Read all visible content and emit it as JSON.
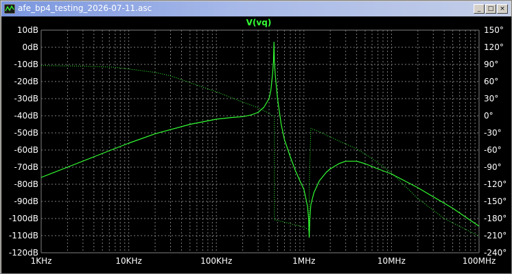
{
  "window": {
    "title": "afe_bp4_testing_2026-07-11.asc",
    "buttons": {
      "minimize": "_",
      "restore": "□",
      "close": "×"
    }
  },
  "colors": {
    "background": "#000000",
    "grid": "#808080",
    "axis_text": "#ffffff",
    "trace": "#33ff33",
    "title_text": "#33ff33"
  },
  "chart_data": {
    "type": "line",
    "title": "V(vq)",
    "x_scale": "log",
    "xlim": [
      1000,
      100000000
    ],
    "x_ticks": [
      {
        "value": 1000,
        "label": "1KHz"
      },
      {
        "value": 10000,
        "label": "10KHz"
      },
      {
        "value": 100000,
        "label": "100KHz"
      },
      {
        "value": 1000000,
        "label": "1MHz"
      },
      {
        "value": 10000000,
        "label": "10MHz"
      },
      {
        "value": 100000000,
        "label": "100MHz"
      }
    ],
    "y_left": {
      "unit": "dB",
      "ylim": [
        -120,
        10
      ],
      "ticks": [
        {
          "value": 10,
          "label": "10dB"
        },
        {
          "value": 0,
          "label": "0dB"
        },
        {
          "value": -10,
          "label": "-10dB"
        },
        {
          "value": -20,
          "label": "-20dB"
        },
        {
          "value": -30,
          "label": "-30dB"
        },
        {
          "value": -40,
          "label": "-40dB"
        },
        {
          "value": -50,
          "label": "-50dB"
        },
        {
          "value": -60,
          "label": "-60dB"
        },
        {
          "value": -70,
          "label": "-70dB"
        },
        {
          "value": -80,
          "label": "-80dB"
        },
        {
          "value": -90,
          "label": "-90dB"
        },
        {
          "value": -100,
          "label": "-100dB"
        },
        {
          "value": -110,
          "label": "-110dB"
        },
        {
          "value": -120,
          "label": "-120dB"
        }
      ]
    },
    "y_right": {
      "unit": "deg",
      "ylim": [
        -240,
        150
      ],
      "ticks": [
        {
          "value": 150,
          "label": "150°"
        },
        {
          "value": 120,
          "label": "120°"
        },
        {
          "value": 90,
          "label": "90°"
        },
        {
          "value": 60,
          "label": "60°"
        },
        {
          "value": 30,
          "label": "30°"
        },
        {
          "value": 0,
          "label": "0°"
        },
        {
          "value": -30,
          "label": "-30°"
        },
        {
          "value": -60,
          "label": "-60°"
        },
        {
          "value": -90,
          "label": "-90°"
        },
        {
          "value": -120,
          "label": "-120°"
        },
        {
          "value": -150,
          "label": "-150°"
        },
        {
          "value": -180,
          "label": "-180°"
        },
        {
          "value": -210,
          "label": "-210°"
        },
        {
          "value": -240,
          "label": "-240°"
        }
      ]
    },
    "grid": true,
    "series": [
      {
        "quantity": "magnitude",
        "axis": "left",
        "style": "solid",
        "points": [
          [
            1000,
            -76
          ],
          [
            2000,
            -70
          ],
          [
            5000,
            -62
          ],
          [
            10000,
            -56
          ],
          [
            20000,
            -50.5
          ],
          [
            50000,
            -45
          ],
          [
            100000,
            -42
          ],
          [
            150000,
            -41
          ],
          [
            200000,
            -40.5
          ],
          [
            250000,
            -39.5
          ],
          [
            300000,
            -38
          ],
          [
            350000,
            -35
          ],
          [
            400000,
            -30
          ],
          [
            420000,
            -25
          ],
          [
            440000,
            -15
          ],
          [
            450000,
            -8
          ],
          [
            455000,
            3
          ],
          [
            460000,
            -8
          ],
          [
            470000,
            -16
          ],
          [
            500000,
            -30
          ],
          [
            550000,
            -45
          ],
          [
            600000,
            -54
          ],
          [
            700000,
            -64
          ],
          [
            800000,
            -72
          ],
          [
            900000,
            -78
          ],
          [
            1000000,
            -83
          ],
          [
            1050000,
            -88
          ],
          [
            1100000,
            -93
          ],
          [
            1130000,
            -100
          ],
          [
            1150000,
            -111
          ],
          [
            1170000,
            -100
          ],
          [
            1200000,
            -92
          ],
          [
            1300000,
            -85
          ],
          [
            1500000,
            -78
          ],
          [
            1800000,
            -73
          ],
          [
            2000000,
            -71
          ],
          [
            2500000,
            -68
          ],
          [
            3000000,
            -66.5
          ],
          [
            4000000,
            -66.5
          ],
          [
            5000000,
            -68
          ],
          [
            7000000,
            -71
          ],
          [
            10000000,
            -74
          ],
          [
            20000000,
            -82
          ],
          [
            50000000,
            -94
          ],
          [
            100000000,
            -104.5
          ]
        ]
      },
      {
        "quantity": "phase",
        "axis": "right",
        "style": "dotted",
        "points": [
          [
            1000,
            88
          ],
          [
            3000,
            87
          ],
          [
            7000,
            85
          ],
          [
            10000,
            82
          ],
          [
            20000,
            76
          ],
          [
            30000,
            70
          ],
          [
            50000,
            58
          ],
          [
            100000,
            42
          ],
          [
            200000,
            24
          ],
          [
            300000,
            14
          ],
          [
            380000,
            6
          ],
          [
            440000,
            0
          ],
          [
            460000,
            0
          ],
          [
            460000,
            -182
          ],
          [
            1000000,
            -195
          ],
          [
            1150000,
            -200
          ],
          [
            1150000,
            -125
          ],
          [
            1200000,
            -22
          ],
          [
            1600000,
            -30
          ],
          [
            2500000,
            -44
          ],
          [
            4000000,
            -58
          ],
          [
            6000000,
            -75
          ],
          [
            10000000,
            -100
          ],
          [
            20000000,
            -145
          ],
          [
            40000000,
            -180
          ],
          [
            100000000,
            -211
          ]
        ]
      }
    ]
  }
}
